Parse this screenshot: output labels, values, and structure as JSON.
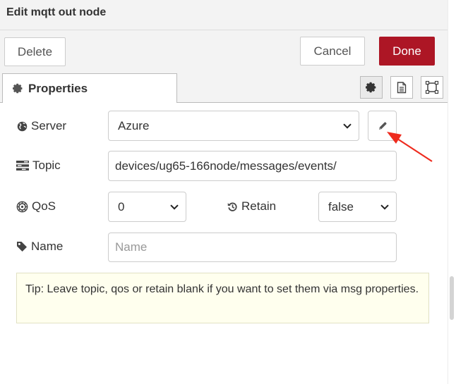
{
  "tray": {
    "title": "Edit mqtt out node"
  },
  "toolbar": {
    "delete_label": "Delete",
    "cancel_label": "Cancel",
    "done_label": "Done"
  },
  "tabs": {
    "properties_label": "Properties"
  },
  "form": {
    "server": {
      "label": "Server",
      "value": "Azure"
    },
    "topic": {
      "label": "Topic",
      "value": "devices/ug65-166node/messages/events/"
    },
    "qos": {
      "label": "QoS",
      "value": "0"
    },
    "retain": {
      "label": "Retain",
      "value": "false"
    },
    "name": {
      "label": "Name",
      "value": "",
      "placeholder": "Name"
    }
  },
  "tip": "Tip: Leave topic, qos or retain blank if you want to set them via msg properties.",
  "icons": {
    "tab": "gear-icon",
    "server": "globe-icon",
    "topic": "tasks-icon",
    "qos": "empire-icon",
    "retain": "history-icon",
    "name": "tag-icon",
    "edit": "pencil-icon",
    "tab_buttons": [
      "gear-icon",
      "file-icon",
      "frame-icon"
    ]
  },
  "colors": {
    "primary": "#ad1625",
    "tip_bg": "#ffffee",
    "annotation_arrow": "#ee2b1e"
  }
}
